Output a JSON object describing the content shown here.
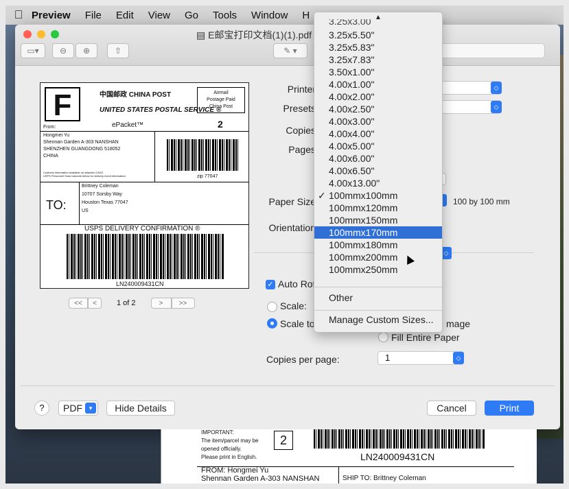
{
  "menubar": {
    "app": "Preview",
    "items": [
      "File",
      "Edit",
      "View",
      "Go",
      "Tools",
      "Window",
      "H"
    ]
  },
  "window": {
    "title": "E邮宝打印文档(1)(1).pdf"
  },
  "label_doc": {
    "big_letter": "F",
    "china_post": "中国邮政 CHINA POST",
    "usps": "UNITED STATES POSTAL SERVICE ®",
    "epacket": "ePacket™",
    "airmail": [
      "Airmail",
      "Postage Paid",
      "China Post"
    ],
    "number": "2",
    "from_label": "From:",
    "from_lines": [
      "Hongmei Yu",
      "Shennan Garden A-303 NANSHAN",
      "SHENZHEN GUANGDONG 518052",
      "CHINA"
    ],
    "customs_note": "Customs information available on attached CN22.",
    "usps_note": "USPS Personnel Scan barcode below for delivery event information",
    "zip": "zip 77047",
    "to_label": "TO:",
    "to_lines": [
      "Brittney Coleman",
      "10707 Sorsby Way",
      "Houston Texas 77047",
      "US"
    ],
    "confirmation": "USPS DELIVERY CONFIRMATION ®",
    "tracking": "LN240009431CN"
  },
  "pager": {
    "first": "<<",
    "prev": "<",
    "text": "1 of 2",
    "next": ">",
    "last": ">>"
  },
  "print_options": {
    "printer_label": "Printer",
    "presets_label": "Presets",
    "copies_label": "Copies",
    "pages_label": "Pages",
    "paper_size_label": "Paper Size",
    "paper_size_desc": "100 by 100 mm",
    "orientation_label": "Orientation",
    "auto_rotate_label": "Auto Rot",
    "scale_label": "Scale:",
    "scale_to_label": "Scale to",
    "image_tail": "mage",
    "fill_paper_label": "Fill Entire Paper",
    "copies_per_page_label": "Copies per page:",
    "copies_per_page_value": "1"
  },
  "paper_menu": {
    "clipped_top": "3.25x3.00",
    "items": [
      "3.25x5.50\"",
      "3.25x5.83\"",
      "3.25x7.83\"",
      "3.50x1.00\"",
      "4.00x1.00\"",
      "4.00x2.00\"",
      "4.00x2.50\"",
      "4.00x3.00\"",
      "4.00x4.00\"",
      "4.00x5.00\"",
      "4.00x6.00\"",
      "4.00x6.50\"",
      "4.00x13.00\"",
      "100mmx100mm",
      "100mmx120mm",
      "100mmx150mm",
      "100mmx170mm",
      "100mmx180mm",
      "100mmx200mm",
      "100mmx250mm"
    ],
    "checked": "100mmx100mm",
    "highlighted": "100mmx170mm",
    "other": "Other",
    "manage": "Manage Custom Sizes..."
  },
  "footer": {
    "help": "?",
    "pdf": "PDF",
    "hide_details": "Hide Details",
    "cancel": "Cancel",
    "print": "Print"
  },
  "bg_doc": {
    "important_lines": [
      "IMPORTANT:",
      "The item/parcel may be",
      "opened officially.",
      "Please print in English."
    ],
    "number": "2",
    "tracking": "LN240009431CN",
    "from": "FROM: Hongmei Yu",
    "from_addr": "Shennan Garden A-303 NANSHAN",
    "ship_to": "SHIP TO: Brittney  Coleman"
  },
  "colors": {
    "accent": "#2f7bf5",
    "highlight": "#2f6fd6"
  }
}
